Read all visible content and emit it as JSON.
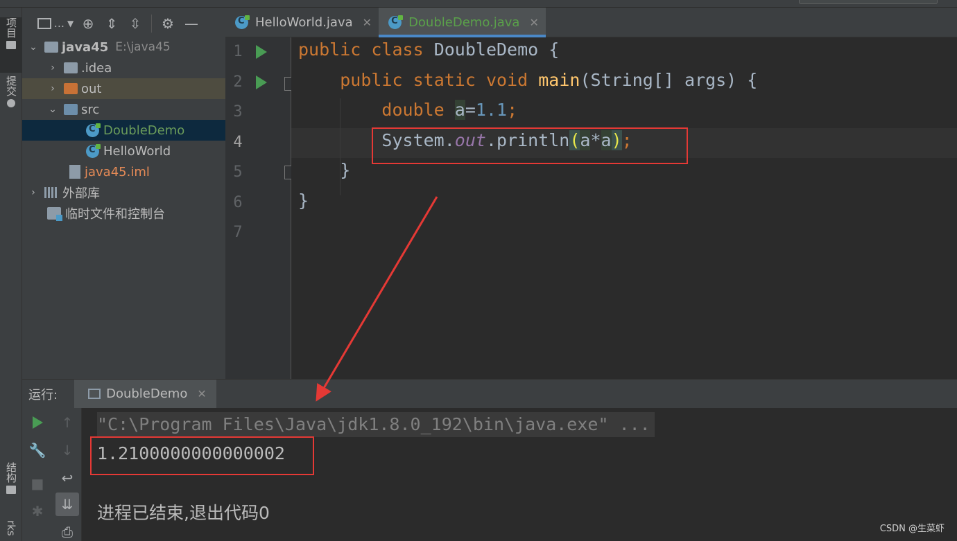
{
  "colors": {
    "annotation_red": "#e53935",
    "selection": "#0d293e",
    "keyword": "#cc7832",
    "accent_tab": "#4a88c7"
  },
  "left_stripe": {
    "project_label": "项目",
    "commit_label": "提交",
    "structure_label": "结构",
    "bookmarks_label": "rks"
  },
  "project_toolbar": {
    "view_label": "...",
    "icons": [
      "project-view-icon",
      "locate-icon",
      "expand-all-icon",
      "collapse-all-icon",
      "settings-icon",
      "hide-icon"
    ]
  },
  "tree": {
    "root_name": "java45",
    "root_path": "E:\\java45",
    "idea": ".idea",
    "out": "out",
    "src": "src",
    "double_demo": "DoubleDemo",
    "hello_world": "HelloWorld",
    "iml": "java45.iml",
    "external_libs": "外部库",
    "scratches": "临时文件和控制台"
  },
  "tabs": [
    {
      "label": "HelloWorld.java",
      "active": false
    },
    {
      "label": "DoubleDemo.java",
      "active": true
    }
  ],
  "editor": {
    "line_numbers": [
      "1",
      "2",
      "3",
      "4",
      "5",
      "6",
      "7"
    ],
    "current_line": 4,
    "code": {
      "l1_kw1": "public",
      "l1_kw2": "class",
      "l1_name": "DoubleDemo",
      "l1_brace": "{",
      "l2_kw1": "public",
      "l2_kw2": "static",
      "l2_kw3": "void",
      "l2_fn": "main",
      "l2_rest": "(String[] args) {",
      "l3_kw": "double",
      "l3_var": "a",
      "l3_eq": "=",
      "l3_num": "1.1",
      "l3_semi": ";",
      "l4_sys": "System.",
      "l4_field": "out",
      "l4_call": ".println",
      "l4_open": "(",
      "l4_a1": "a",
      "l4_op": "*",
      "l4_a2": "a",
      "l4_close": ")",
      "l4_semi": ";",
      "l5": "}",
      "l6": "}"
    }
  },
  "run_panel": {
    "label": "运行:",
    "tab_label": "DoubleDemo",
    "command": "\"C:\\Program Files\\Java\\jdk1.8.0_192\\bin\\java.exe\" ...",
    "output": "1.2100000000000002",
    "exit_message": "进程已结束,退出代码0"
  },
  "watermark": "CSDN @生菜虾"
}
